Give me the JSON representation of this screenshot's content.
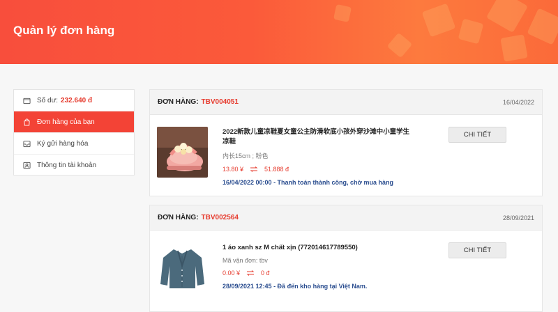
{
  "header": {
    "title": "Quản lý đơn hàng"
  },
  "sidebar": {
    "balance_label": "Số dư:",
    "balance_value": "232.640 đ",
    "items": [
      {
        "label": "Đơn hàng của bạn",
        "icon": "bag-icon",
        "active": true
      },
      {
        "label": "Ký gửi hàng hóa",
        "icon": "inbox-icon",
        "active": false
      },
      {
        "label": "Thông tin tài khoản",
        "icon": "user-icon",
        "active": false
      }
    ]
  },
  "orders": [
    {
      "label": "ĐƠN HÀNG:",
      "code": "TBV004051",
      "date": "16/04/2022",
      "product_name": "2022新款儿童凉鞋夏女童公主防滑软底小孩外穿沙滩中小童学生凉鞋",
      "variant": "内长15cm ; 粉色",
      "price_cny": "13.80 ¥",
      "price_vnd": "51.888 đ",
      "status": "16/04/2022 00:00 - Thanh toán thành công, chờ mua hàng",
      "button": "CHI TIẾT"
    },
    {
      "label": "ĐƠN HÀNG:",
      "code": "TBV002564",
      "date": "28/09/2021",
      "product_name": "1 áo xanh sz M chất xịn (772014617789550)",
      "variant": "Mã vận đơn: tbv",
      "price_cny": "0.00 ¥",
      "price_vnd": "0 đ",
      "status": "28/09/2021 12:45 - Đã đến kho hàng tại Việt Nam.",
      "button": "CHI TIẾT"
    }
  ],
  "colors": {
    "accent": "#f34336",
    "header_start": "#f84e3c",
    "header_end": "#fd7a3e",
    "status_text": "#2a4d8f"
  }
}
